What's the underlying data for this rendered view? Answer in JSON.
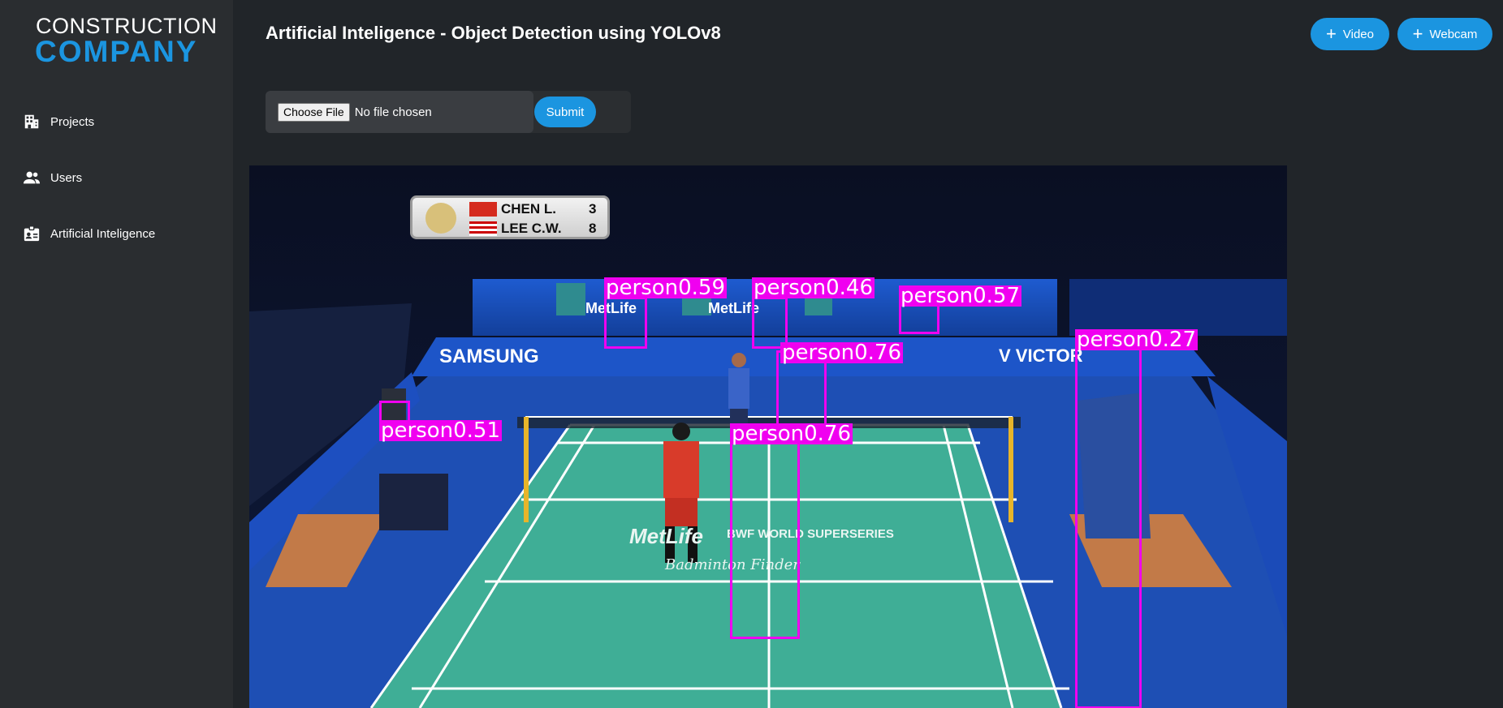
{
  "brand": {
    "line1": "CONSTRUCTION",
    "line2": "COMPANY"
  },
  "sidebar": {
    "items": [
      {
        "label": "Projects",
        "icon": "building-icon"
      },
      {
        "label": "Users",
        "icon": "users-icon"
      },
      {
        "label": "Artificial Inteligence",
        "icon": "id-badge-icon"
      }
    ]
  },
  "header": {
    "title": "Artificial Inteligence - Object Detection using YOLOv8",
    "video_button": "Video",
    "webcam_button": "Webcam"
  },
  "upload": {
    "choose_label": "Choose File",
    "status": "No file chosen",
    "submit_label": "Submit"
  },
  "scoreboard": {
    "players": [
      {
        "name": "CHEN L.",
        "score": "3"
      },
      {
        "name": "LEE C.W.",
        "score": "8"
      }
    ]
  },
  "detections": [
    {
      "label": "person0.59"
    },
    {
      "label": "person0.46"
    },
    {
      "label": "person0.57"
    },
    {
      "label": "person0.27"
    },
    {
      "label": "person0.76"
    },
    {
      "label": "person0.51"
    },
    {
      "label": "person0.76"
    }
  ],
  "colors": {
    "accent": "#1b95e0",
    "detection": "#f000f0",
    "court": "#3fae96"
  }
}
